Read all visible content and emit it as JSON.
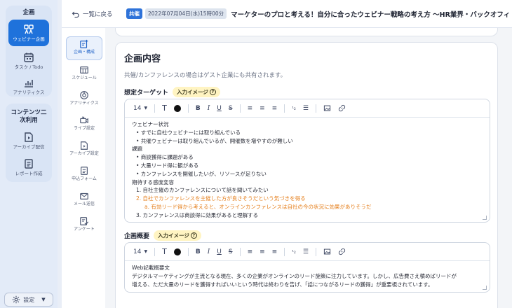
{
  "sidebar": {
    "section1_title": "企画",
    "items": [
      {
        "label": "ウェビナー企画",
        "icon": "webinar-plan-icon"
      },
      {
        "label": "タスク / Todo",
        "icon": "calendar-icon"
      },
      {
        "label": "アナリティクス",
        "icon": "analytics-chart-icon"
      }
    ],
    "section2_title": "コンテンツ二次利用",
    "items2": [
      {
        "label": "アーカイブ配信",
        "icon": "archive-file-icon"
      },
      {
        "label": "レポート作成",
        "icon": "report-doc-icon"
      }
    ],
    "settings_label": "設定"
  },
  "header": {
    "back_label": "一覧に戻る",
    "badge": "共催",
    "datetime": "2022年07月04日(水)15時00分",
    "title": "マーケターのプロと考える！自分に合ったウェビナー戦略の考え方 〜HR業界・バックオフィ"
  },
  "tabs": [
    {
      "label": "企画・構成",
      "icon": "plan-edit-icon"
    },
    {
      "label": "スケジュール",
      "icon": "schedule-icon"
    },
    {
      "label": "アナリティクス",
      "icon": "analytics-icon"
    },
    {
      "label": "ライブ設定",
      "icon": "video-camera-icon"
    },
    {
      "label": "アーカイブ設定",
      "icon": "archive-settings-icon"
    },
    {
      "label": "申込フォーム",
      "icon": "form-icon"
    },
    {
      "label": "メール送信",
      "icon": "mail-icon"
    },
    {
      "label": "アンケート",
      "icon": "survey-icon"
    }
  ],
  "content": {
    "heading": "企画内容",
    "note": "共催/カンファレンスの場合はゲスト企業にも共有されます。",
    "field1": {
      "label": "想定ターゲット",
      "pill": "入力イメージ",
      "font_size": "14",
      "lines": [
        {
          "text": "ウェビナー状況",
          "cls": ""
        },
        {
          "text": "• すでに自社ウェビナーには取り組んでいる",
          "cls": "i1"
        },
        {
          "text": "• 共催ウェビナーは取り組んでいるが、開催数を増やすのが難しい",
          "cls": "i1"
        },
        {
          "text": "課題",
          "cls": ""
        },
        {
          "text": "• 商談獲得に課題がある",
          "cls": "i1"
        },
        {
          "text": "• 大量リード得に観がある",
          "cls": "i1"
        },
        {
          "text": "• カンファレンスを開催したいが、リソースが足りない",
          "cls": "i1"
        },
        {
          "text": "期待する感度変容",
          "cls": ""
        },
        {
          "text": "1. 自社主催のカンファレンスについて話を聞いてみたい",
          "cls": "i1"
        },
        {
          "text": "2. 自社でカンファレンスを主催した方が良さそうだという気づきを得る",
          "cls": "i1 o"
        },
        {
          "text": "a. 有効リード得から考えると、オンラインカンファレンスは自社の今の状況に効果がありそうだ",
          "cls": "i2 o"
        },
        {
          "text": "3. カンファレンスは商談得に効果があると理解する",
          "cls": "i1"
        }
      ]
    },
    "field2": {
      "label": "企画概要",
      "pill": "入力イメージ",
      "font_size": "14",
      "lines": [
        {
          "text": "Web記載概要文",
          "cls": ""
        },
        {
          "text": "デジタルマーケティングが主流となる現在、多くの企業がオンラインのリード施策に注力しています。しかし、広告費さえ積めばリードが",
          "cls": ""
        },
        {
          "text": "増える、ただ大量のリードを獲得すればいいという時代は終わりを告げ、「話につながるリードの獲得」が重要視されています。",
          "cls": ""
        }
      ]
    }
  },
  "colors": {
    "accent": "#1f72db",
    "highlight": "#e57f1c",
    "pill_bg": "#fff4c2"
  }
}
